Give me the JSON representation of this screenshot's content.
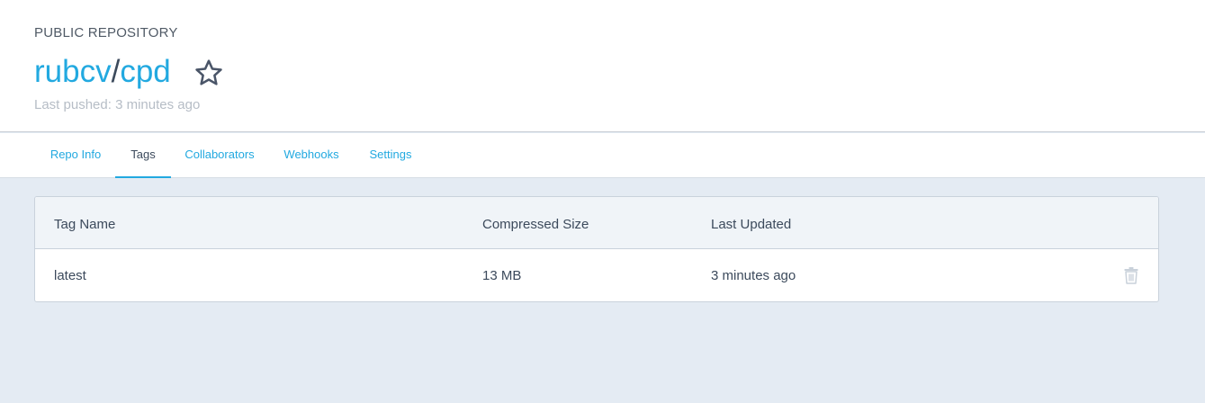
{
  "header": {
    "repo_kind": "PUBLIC REPOSITORY",
    "namespace": "rubcv",
    "separator": "/",
    "repo_name": "cpd",
    "last_pushed": "Last pushed: 3 minutes ago",
    "star_icon": "star-outline-icon"
  },
  "tabs": [
    {
      "label": "Repo Info",
      "active": false
    },
    {
      "label": "Tags",
      "active": true
    },
    {
      "label": "Collaborators",
      "active": false
    },
    {
      "label": "Webhooks",
      "active": false
    },
    {
      "label": "Settings",
      "active": false
    }
  ],
  "table": {
    "columns": [
      "Tag Name",
      "Compressed Size",
      "Last Updated"
    ],
    "rows": [
      {
        "tag": "latest",
        "size": "13 MB",
        "updated": "3 minutes ago",
        "action_icon": "trash-icon"
      }
    ]
  },
  "colors": {
    "accent": "#22a9e0",
    "text": "#3c4a5c",
    "muted": "#b6bdc6",
    "background": "#e4ebf3"
  }
}
